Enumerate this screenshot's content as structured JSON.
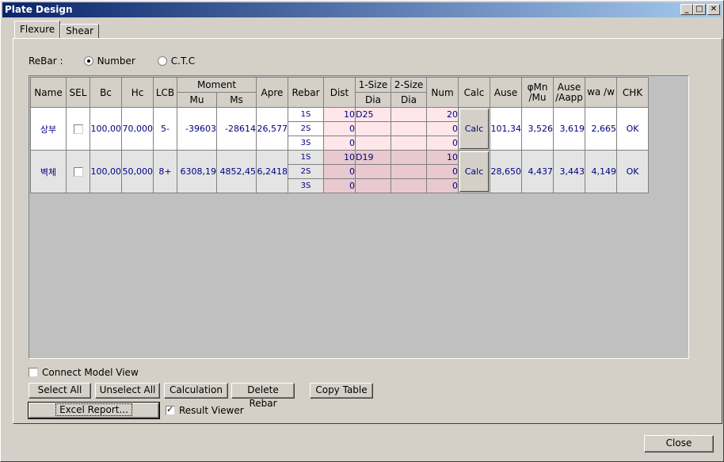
{
  "window": {
    "title": "Plate Design",
    "minimize": "_",
    "maximize": "□",
    "close": "✕"
  },
  "tabs": [
    {
      "label": "Flexure",
      "active": true
    },
    {
      "label": "Shear",
      "active": false
    }
  ],
  "rebar": {
    "label": "ReBar :",
    "options": [
      {
        "label": "Number",
        "selected": true
      },
      {
        "label": "C.T.C",
        "selected": false
      }
    ]
  },
  "grid": {
    "headers": {
      "name": "Name",
      "sel": "SEL",
      "bc": "Bc",
      "hc": "Hc",
      "lcb": "LCB",
      "moment": "Moment",
      "mu": "Mu",
      "ms": "Ms",
      "apre": "Apre",
      "rebar": "Rebar",
      "dist": "Dist",
      "size1": "1-Size",
      "size2": "2-Size",
      "dia1": "Dia",
      "dia2": "Dia",
      "num": "Num",
      "calc": "Calc",
      "ause": "Ause",
      "phimn": "φMn /Mu",
      "auseaapp": "Ause /Aapp",
      "waw": "wa /w",
      "chk": "CHK"
    },
    "rows": [
      {
        "name": "상부",
        "sel": false,
        "bc": "100,00",
        "hc": "70,000",
        "lcb": "5-",
        "mu": "-39603",
        "ms": "-28614",
        "apre": "26,577",
        "layers": [
          {
            "rebar": "1S",
            "dist": "10",
            "dia1": "D25",
            "dia2": "",
            "num": "20"
          },
          {
            "rebar": "2S",
            "dist": "0",
            "dia1": "",
            "dia2": "",
            "num": "0"
          },
          {
            "rebar": "3S",
            "dist": "0",
            "dia1": "",
            "dia2": "",
            "num": "0"
          }
        ],
        "calc": "Calc",
        "ause": "101,34",
        "phimn": "3,526",
        "auseaapp": "3,619",
        "waw": "2,665",
        "chk": "OK"
      },
      {
        "name": "벽체",
        "sel": false,
        "bc": "100,00",
        "hc": "50,000",
        "lcb": "8+",
        "mu": "6308,19",
        "ms": "4852,45",
        "apre": "6,2418",
        "layers": [
          {
            "rebar": "1S",
            "dist": "10",
            "dia1": "D19",
            "dia2": "",
            "num": "10"
          },
          {
            "rebar": "2S",
            "dist": "0",
            "dia1": "",
            "dia2": "",
            "num": "0"
          },
          {
            "rebar": "3S",
            "dist": "0",
            "dia1": "",
            "dia2": "",
            "num": "0"
          }
        ],
        "calc": "Calc",
        "ause": "28,650",
        "phimn": "4,437",
        "auseaapp": "3,443",
        "waw": "4,149",
        "chk": "OK"
      }
    ]
  },
  "options": {
    "connect_model_view": {
      "label": "Connect Model View",
      "checked": false
    },
    "result_viewer": {
      "label": "Result Viewer",
      "checked": true
    }
  },
  "buttons": {
    "select_all": "Select All",
    "unselect_all": "Unselect All",
    "calculation": "Calculation",
    "delete_rebar": "Delete Rebar",
    "copy_table": "Copy Table",
    "excel_report": "Excel Report...",
    "close": "Close"
  }
}
